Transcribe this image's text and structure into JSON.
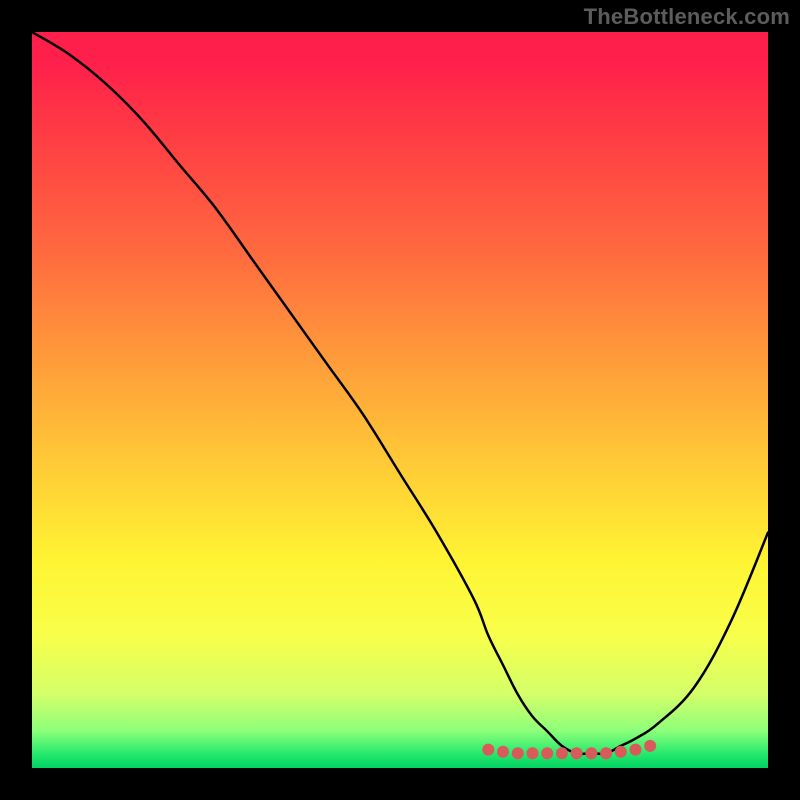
{
  "watermark": "TheBottleneck.com",
  "chart_data": {
    "type": "line",
    "title": "",
    "xlabel": "",
    "ylabel": "",
    "xlim": [
      0,
      100
    ],
    "ylim": [
      0,
      100
    ],
    "series": [
      {
        "name": "bottleneck-curve",
        "x": [
          0,
          5,
          10,
          15,
          20,
          25,
          30,
          35,
          40,
          45,
          50,
          55,
          60,
          62,
          64,
          66,
          68,
          70,
          72,
          74,
          76,
          78,
          80,
          82,
          85,
          90,
          95,
          100
        ],
        "y": [
          100,
          97,
          93,
          88,
          82,
          76,
          69,
          62,
          55,
          48,
          40,
          32,
          23,
          18,
          14,
          10,
          7,
          5,
          3,
          2,
          2,
          2,
          3,
          4,
          6,
          11,
          20,
          32
        ]
      }
    ],
    "markers": {
      "name": "valley-dots",
      "x": [
        62,
        64,
        66,
        68,
        70,
        72,
        74,
        76,
        78,
        80,
        82,
        84
      ],
      "y": [
        2.5,
        2.2,
        2.0,
        2.0,
        2.0,
        2.0,
        2.0,
        2.0,
        2.0,
        2.2,
        2.5,
        3.0
      ]
    },
    "background": {
      "type": "vertical-gradient",
      "stops": [
        {
          "pos": 0,
          "color": "#ff1f4b"
        },
        {
          "pos": 30,
          "color": "#ff6a3f"
        },
        {
          "pos": 60,
          "color": "#ffc837"
        },
        {
          "pos": 82,
          "color": "#f8ff4a"
        },
        {
          "pos": 95,
          "color": "#8cff7a"
        },
        {
          "pos": 100,
          "color": "#00d362"
        }
      ]
    }
  }
}
